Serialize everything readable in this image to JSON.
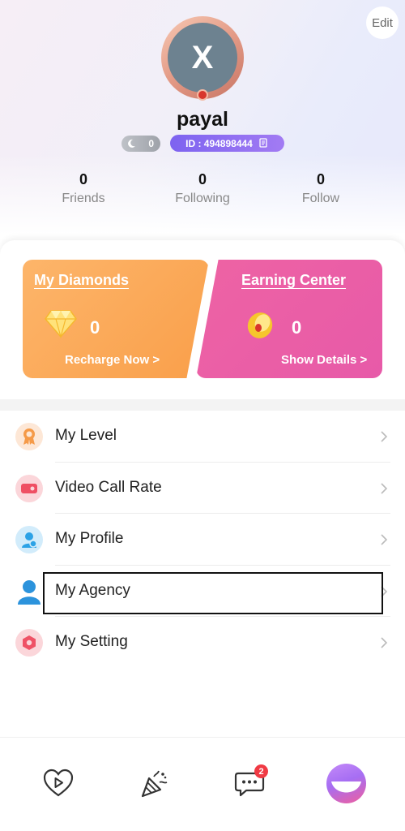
{
  "header": {
    "edit_label": "Edit",
    "avatar_letter": "X",
    "username": "payal",
    "moon_level": "0",
    "user_id": "ID : 494898444"
  },
  "stats": [
    {
      "value": "0",
      "label": "Friends"
    },
    {
      "value": "0",
      "label": "Following"
    },
    {
      "value": "0",
      "label": "Follow"
    }
  ],
  "cards": {
    "diamonds": {
      "title": "My Diamonds",
      "value": "0",
      "link": "Recharge Now >"
    },
    "earning": {
      "title": "Earning Center",
      "value": "0",
      "link": "Show Details >"
    }
  },
  "menu": [
    {
      "label": "My Level",
      "icon": "level-medal-icon"
    },
    {
      "label": "Video Call Rate",
      "icon": "video-call-icon"
    },
    {
      "label": "My Profile",
      "icon": "profile-icon"
    },
    {
      "label": "My Agency",
      "icon": "agency-person-icon"
    },
    {
      "label": "My Setting",
      "icon": "settings-icon"
    }
  ],
  "tabbar": {
    "messages_badge": "2",
    "tabs": [
      "heart-play-icon",
      "party-popper-icon",
      "chat-bubble-icon",
      "me-smile-icon"
    ]
  },
  "colors": {
    "diamond_card": "#f9a54f",
    "earning_card": "#ea5ea6",
    "id_badge": "#8b6cf1",
    "badge_red": "#f03a44"
  }
}
